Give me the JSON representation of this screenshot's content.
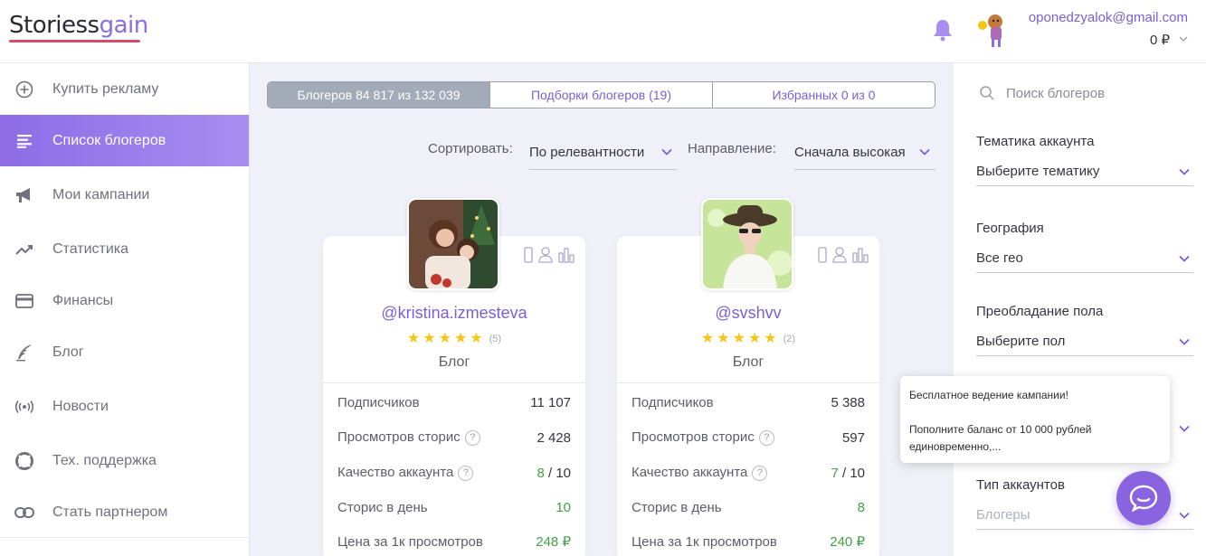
{
  "header": {
    "logo_part1": "Storiess",
    "logo_part2": "gain",
    "email": "oponedzyalok@gmail.com",
    "balance": "0 ₽"
  },
  "sidebar": {
    "items": [
      {
        "label": "Купить рекламу",
        "icon": "plus-circle-icon"
      },
      {
        "label": "Список блогеров",
        "icon": "list-icon"
      },
      {
        "label": "Мои кампании",
        "icon": "megaphone-icon"
      },
      {
        "label": "Статистика",
        "icon": "trend-icon"
      },
      {
        "label": "Финансы",
        "icon": "card-icon"
      },
      {
        "label": "Блог",
        "icon": "quill-icon"
      },
      {
        "label": "Новости",
        "icon": "broadcast-icon"
      },
      {
        "label": "Тех. поддержка",
        "icon": "lifebuoy-icon"
      },
      {
        "label": "Стать партнером",
        "icon": "link-icon"
      }
    ],
    "active_index": 1
  },
  "tabs": [
    {
      "label": "Блогеров 84 817 из 132 039",
      "active": true
    },
    {
      "label": "Подборки блогеров (19)",
      "active": false
    },
    {
      "label": "Избранных 0 из 0",
      "active": false
    }
  ],
  "sort": {
    "label": "Сортировать:",
    "value": "По релевантности",
    "direction_label": "Направление:",
    "direction_value": "Сначала высокая"
  },
  "cards": [
    {
      "handle": "@kristina.izmesteva",
      "stars": 5,
      "reviews": "(5)",
      "type": "Блог",
      "subscribers_label": "Подписчиков",
      "subscribers": "11 107",
      "views_label": "Просмотров сторис",
      "views": "2 428",
      "quality_label": "Качество аккаунта",
      "quality_score": "8",
      "quality_max": " / 10",
      "stories_label": "Сторис в день",
      "stories": "10",
      "price_label": "Цена за 1к просмотров",
      "price": "248 ₽"
    },
    {
      "handle": "@svshvv",
      "stars": 5,
      "reviews": "(2)",
      "type": "Блог",
      "subscribers_label": "Подписчиков",
      "subscribers": "5 388",
      "views_label": "Просмотров сторис",
      "views": "597",
      "quality_label": "Качество аккаунта",
      "quality_score": "7",
      "quality_max": " / 10",
      "stories_label": "Сторис в день",
      "stories": "8",
      "price_label": "Цена за 1к просмотров",
      "price": "240 ₽"
    }
  ],
  "filters": {
    "search_placeholder": "Поиск блогеров",
    "topic_label": "Тематика аккаунта",
    "topic_value": "Выберите тематику",
    "geo_label": "География",
    "geo_value": "Все гео",
    "gender_label": "Преобладание пола",
    "gender_value": "Выберите пол",
    "type_label": "Тип аккаунтов",
    "type_value": "Блогеры"
  },
  "popup": {
    "line1": "Бесплатное ведение кампании!",
    "line2": "Пополните баланс от 10 000 рублей единовременно,..."
  },
  "colors": {
    "accent": "#8d6ce6",
    "link": "#7a5fd6",
    "green": "#43a047",
    "star": "#f5c518"
  }
}
